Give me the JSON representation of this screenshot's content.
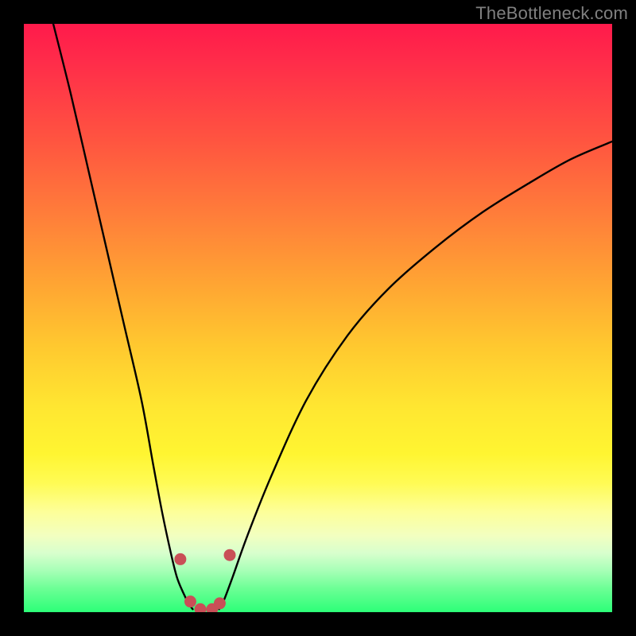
{
  "watermark": "TheBottleneck.com",
  "colors": {
    "frame_border": "#000000",
    "curve_stroke": "#000000",
    "dot_fill": "#c94f57",
    "gradient_stops": [
      "#ff1a4b",
      "#ff2b4a",
      "#ff5540",
      "#ff7c3a",
      "#ffa433",
      "#ffc92f",
      "#ffe631",
      "#fff531",
      "#fffb54",
      "#fdff9a",
      "#f2ffc0",
      "#d7ffcd",
      "#a6ffb6",
      "#6cff95",
      "#2cff78"
    ]
  },
  "chart_data": {
    "type": "line",
    "title": "",
    "xlabel": "",
    "ylabel": "",
    "xlim": [
      0,
      100
    ],
    "ylim": [
      0,
      100
    ],
    "grid": false,
    "legend": false,
    "series": [
      {
        "name": "left-branch",
        "x": [
          5,
          8,
          11,
          14,
          17,
          20,
          22,
          23.5,
          25,
          26,
          27,
          28,
          28.7
        ],
        "y": [
          100,
          88,
          75,
          62,
          49,
          36,
          25,
          17,
          10,
          6,
          3.5,
          1.5,
          0.5
        ]
      },
      {
        "name": "right-branch",
        "x": [
          33.2,
          34,
          35.5,
          38,
          42,
          48,
          55,
          62,
          70,
          78,
          86,
          93,
          100
        ],
        "y": [
          0.5,
          2,
          6,
          13,
          23,
          36,
          47,
          55,
          62,
          68,
          73,
          77,
          80
        ]
      }
    ],
    "annotations": [
      {
        "name": "dot-left-upper",
        "x": 26.6,
        "y": 9.0
      },
      {
        "name": "dot-left-lower",
        "x": 28.3,
        "y": 1.8
      },
      {
        "name": "dot-mid-left",
        "x": 30.0,
        "y": 0.5
      },
      {
        "name": "dot-mid-right",
        "x": 32.0,
        "y": 0.5
      },
      {
        "name": "dot-right-lower",
        "x": 33.3,
        "y": 1.5
      },
      {
        "name": "dot-right-upper",
        "x": 35.0,
        "y": 9.7
      }
    ]
  }
}
